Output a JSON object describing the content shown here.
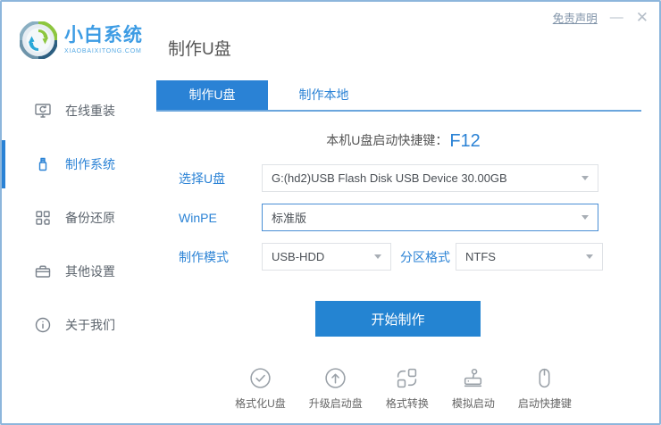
{
  "header": {
    "brand_name": "小白系统",
    "brand_domain": "XIAOBAIXITONG.COM",
    "page_title": "制作U盘",
    "disclaimer": "免责声明",
    "minimize": "—",
    "close": "✕"
  },
  "sidebar": {
    "items": [
      {
        "label": "在线重装",
        "icon": "monitor-reinstall-icon",
        "active": false
      },
      {
        "label": "制作系统",
        "icon": "usb-drive-icon",
        "active": true
      },
      {
        "label": "备份还原",
        "icon": "backup-grid-icon",
        "active": false
      },
      {
        "label": "其他设置",
        "icon": "toolbox-icon",
        "active": false
      },
      {
        "label": "关于我们",
        "icon": "info-icon",
        "active": false
      }
    ]
  },
  "main": {
    "tabs": [
      {
        "label": "制作U盘",
        "active": true
      },
      {
        "label": "制作本地",
        "active": false
      }
    ],
    "hotkey": {
      "label": "本机U盘启动快捷键：",
      "value": "F12"
    },
    "form": {
      "usb": {
        "label": "选择U盘",
        "value": "G:(hd2)USB Flash Disk USB Device 30.00GB"
      },
      "winpe": {
        "label": "WinPE",
        "value": "标准版"
      },
      "mode": {
        "label": "制作模式",
        "value": "USB-HDD"
      },
      "partition": {
        "label": "分区格式",
        "value": "NTFS"
      }
    },
    "start_button": "开始制作",
    "tools": [
      {
        "label": "格式化U盘",
        "icon": "format-check-icon"
      },
      {
        "label": "升级启动盘",
        "icon": "upgrade-arrow-icon"
      },
      {
        "label": "格式转换",
        "icon": "convert-icon"
      },
      {
        "label": "模拟启动",
        "icon": "joystick-icon"
      },
      {
        "label": "启动快捷键",
        "icon": "mouse-icon"
      }
    ]
  },
  "colors": {
    "primary_blue": "#2a82d5",
    "button_blue": "#2484d2",
    "tab_underline": "#6ba6dd",
    "window_border": "#8db6dc",
    "logo_green": "#8dc63f",
    "logo_cyan": "#29a8d8"
  }
}
